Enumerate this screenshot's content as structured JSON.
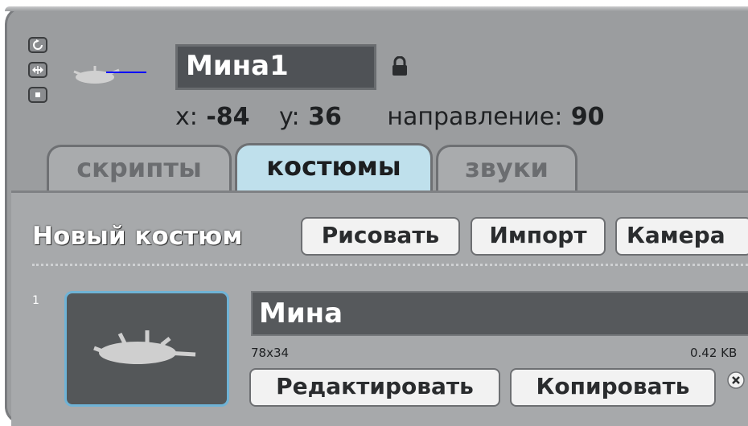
{
  "sprite": {
    "name": "Мина1",
    "x_label": "x:",
    "x_value": "-84",
    "y_label": "y:",
    "y_value": "36",
    "direction_label": "направление:",
    "direction_value": "90"
  },
  "rotation_buttons": [
    "rotate-all-around-icon",
    "left-right-flip-icon",
    "no-rotate-icon"
  ],
  "tabs": [
    {
      "label": "скрипты",
      "active": false
    },
    {
      "label": "костюмы",
      "active": true
    },
    {
      "label": "звуки",
      "active": false
    }
  ],
  "toolbar": {
    "new_costume_label": "Новый костюм",
    "paint_label": "Рисовать",
    "import_label": "Импорт",
    "camera_label": "Камера"
  },
  "costumes": [
    {
      "index": "1",
      "name": "Мина",
      "dimensions": "78x34",
      "size": "0.42 KB",
      "edit_label": "Редактировать",
      "copy_label": "Копировать"
    }
  ],
  "colors": {
    "panel_bg": "#9b9d9f",
    "active_tab": "#bfe0ec",
    "field_bg": "#4f5256",
    "selection_outline": "#6fb3d6"
  }
}
